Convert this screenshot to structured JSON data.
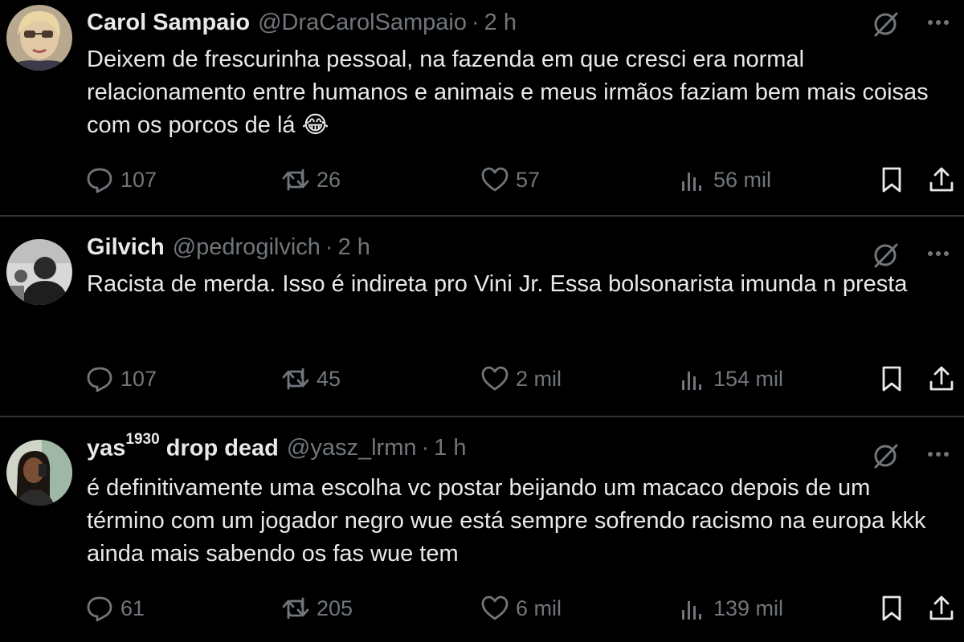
{
  "colors": {
    "background": "#000000",
    "text": "#e7e9ea",
    "muted": "#71767b",
    "divider": "#2f3336"
  },
  "tweets": [
    {
      "name": "Carol Sampaio",
      "name_suffix": "",
      "handle": "@DraCarolSampaio",
      "separator": "·",
      "time": "2 h",
      "text": "Deixem de frescurinha pessoal, na fazenda em que cresci era normal relacionamento entre humanos e animais e meus irmãos faziam bem mais coisas com os porcos de lá 😂",
      "replies": "107",
      "retweets": "26",
      "likes": "57",
      "views": "56 mil"
    },
    {
      "name": "Gilvich",
      "name_suffix": "",
      "handle": "@pedrogilvich",
      "separator": "·",
      "time": "2 h",
      "text": "Racista de merda. Isso é indireta pro Vini Jr. Essa bolsonarista imunda n presta",
      "replies": "107",
      "retweets": "45",
      "likes": "2 mil",
      "views": "154 mil"
    },
    {
      "name": "yas",
      "name_suffix": "1930",
      "name_rest": " drop dead",
      "handle": "@yasz_lrmn",
      "separator": "·",
      "time": "1 h",
      "text": "é definitivamente uma escolha vc postar beijando um macaco depois de um término com um jogador negro wue está sempre sofrendo racismo na europa kkk ainda mais sabendo os fas wue tem",
      "replies": "61",
      "retweets": "205",
      "likes": "6 mil",
      "views": "139 mil"
    }
  ],
  "icons": [
    "reply-icon",
    "retweet-icon",
    "like-icon",
    "views-icon",
    "bookmark-icon",
    "share-icon",
    "grok-icon",
    "more-icon"
  ]
}
